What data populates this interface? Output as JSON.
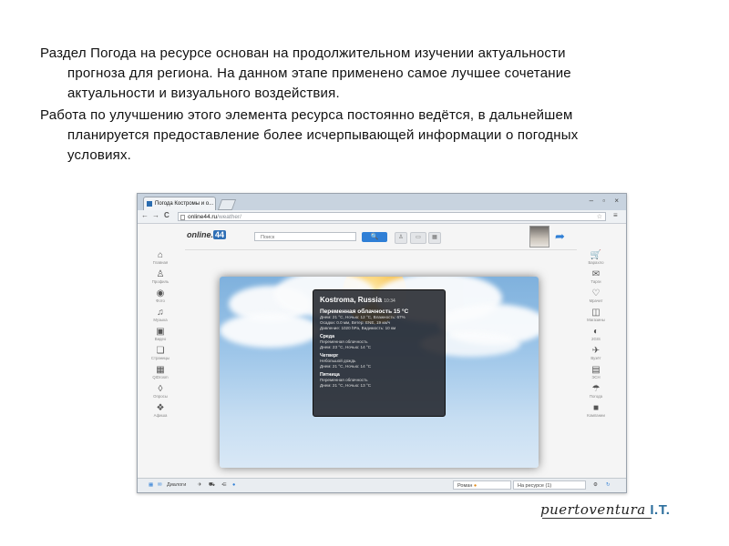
{
  "paragraph1": {
    "line1": "Раздел Погода на ресурсе основан на продолжительном изучении актуальности",
    "line2": "прогноза для региона. На данном этапе применено самое лучшее сочетание",
    "line3": "актуальности и визуального воздействия."
  },
  "paragraph2": {
    "line1": "Работа по улучшению этого элемента ресурса постоянно ведётся, в дальнейшем",
    "line2": "планируется предоставление более исчерпывающей информации о погодных",
    "line3": "условиях."
  },
  "browser": {
    "tab_title": "Погода Костромы и о...",
    "url_domain": "online44.ru",
    "url_path": "/weather/",
    "nav_back": "←",
    "nav_forward": "→",
    "nav_reload": "C",
    "window_buttons": "– ▫ ×"
  },
  "site": {
    "logo_text": "online.",
    "logo_badge": "44",
    "search_placeholder": "Поиск",
    "search_button": "🔍",
    "left_menu": [
      {
        "icon": "⌂",
        "label": "Главная"
      },
      {
        "icon": "♙",
        "label": "Профиль"
      },
      {
        "icon": "◉",
        "label": "Фото"
      },
      {
        "icon": "♫",
        "label": "Музыка"
      },
      {
        "icon": "▣",
        "label": "Видео"
      },
      {
        "icon": "❏",
        "label": "Страницы"
      },
      {
        "icon": "▦",
        "label": "QIDrosm"
      },
      {
        "icon": "◊",
        "label": "Опросы"
      },
      {
        "icon": "❖",
        "label": "Афиша"
      }
    ],
    "right_menu": [
      {
        "icon": "🛒",
        "label": "Барахло"
      },
      {
        "icon": "✉",
        "label": "Тарги"
      },
      {
        "icon": "♡",
        "label": "Мрачит"
      },
      {
        "icon": "◫",
        "label": "Магазины"
      },
      {
        "icon": "◐",
        "label": "2GIS"
      },
      {
        "icon": "✈",
        "label": "Вузёт"
      },
      {
        "icon": "▤",
        "label": "ЭСН"
      },
      {
        "icon": "☂",
        "label": "Погода"
      },
      {
        "icon": "■",
        "label": "Компании"
      }
    ]
  },
  "weather": {
    "city": "Kostroma, Russia",
    "time": "10:34",
    "current_condition": "Переменная облачность 15 °C",
    "current_details": [
      "Днем: 21 °C, Ночью: 12 °C, Влажность: 67%",
      "Осадки: 0.0 мм, Ветер: ENE, 19 км/ч",
      "Давление: 1020 hPa, Видимость: 10 км"
    ],
    "forecast": [
      {
        "day": "Среда",
        "condition": "Переменная облачность",
        "temps": "Днем: 23 °C, Ночью: 14 °C"
      },
      {
        "day": "Четверг",
        "condition": "Небольшой дождь",
        "temps": "Днем: 21 °C, Ночью: 14 °C"
      },
      {
        "day": "Пятница",
        "condition": "Переменная облачность",
        "temps": "Днем: 21 °C, Ночью: 13 °C"
      }
    ]
  },
  "statusbar": {
    "dialogs": "Диалоги",
    "user": "Роман",
    "online": "На ресурсе (1)"
  },
  "brand": {
    "script": "puertoventura",
    "suffix": "I.T."
  },
  "colors": {
    "accent": "#2f7fd6",
    "panel_bg": "#23262c",
    "brand_it": "#2d6f9e"
  }
}
